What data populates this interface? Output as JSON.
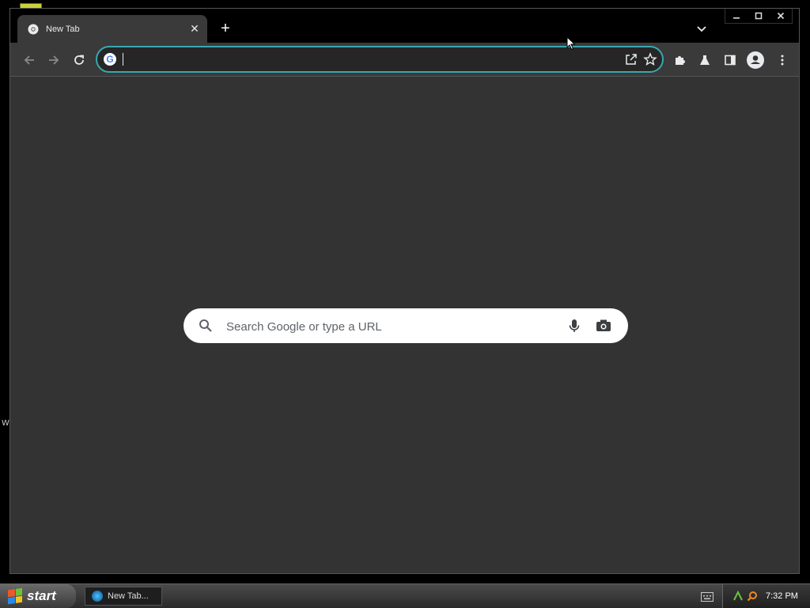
{
  "browser": {
    "tab": {
      "title": "New Tab",
      "close_glyph": "✕"
    },
    "new_tab_glyph": "+",
    "omnibox": {
      "value": "",
      "favicon_letter": "G"
    },
    "accent_color": "#3aa8b0"
  },
  "ntp": {
    "search_placeholder": "Search Google or type a URL"
  },
  "taskbar": {
    "start_label": "start",
    "task_item_label": "New Tab...",
    "clock": "7:32 PM"
  },
  "desktop": {
    "stray_text": "W"
  },
  "icons": {
    "back": "arrow-left-icon",
    "forward": "arrow-right-icon",
    "reload": "reload-icon",
    "share": "share-icon",
    "bookmark": "star-icon",
    "extensions": "puzzle-icon",
    "labs": "flask-icon",
    "side_panel": "side-panel-icon",
    "profile": "profile-icon",
    "menu": "kebab-menu-icon",
    "search": "search-icon",
    "voice": "microphone-icon",
    "lens": "camera-icon"
  }
}
